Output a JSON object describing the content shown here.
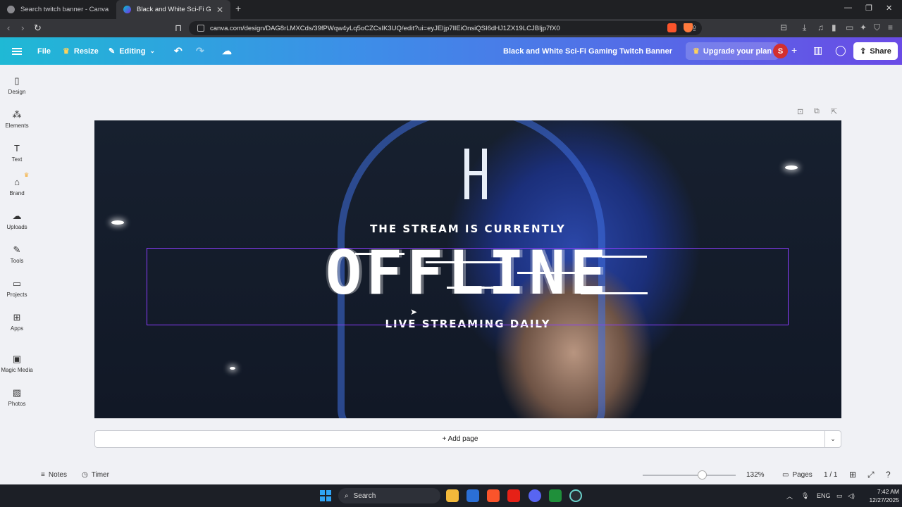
{
  "browser": {
    "tabs": [
      {
        "title": "Search twitch banner - Canva"
      },
      {
        "title": "Black and White Sci-Fi Gaming T"
      }
    ],
    "url": "canva.com/design/DAG8rLMXCds/39fPWqw4yLq5oCZCsIK3UQ/edit?ui=eyJEIjp7IlEiOnsiQSI6dHJ1ZX19LCJBIjp7fX0"
  },
  "header": {
    "file_label": "File",
    "resize_label": "Resize",
    "editing_label": "Editing",
    "doc_title": "Black and White Sci-Fi Gaming Twitch Banner",
    "upgrade_label": "Upgrade your plan",
    "avatar_initial": "S",
    "share_label": "Share"
  },
  "sidebar": {
    "items": [
      {
        "label": "Design",
        "icon": "design-icon"
      },
      {
        "label": "Elements",
        "icon": "elements-icon"
      },
      {
        "label": "Text",
        "icon": "text-icon"
      },
      {
        "label": "Brand",
        "icon": "brand-icon"
      },
      {
        "label": "Uploads",
        "icon": "uploads-icon"
      },
      {
        "label": "Tools",
        "icon": "tools-icon"
      },
      {
        "label": "Projects",
        "icon": "projects-icon"
      },
      {
        "label": "Apps",
        "icon": "apps-icon"
      },
      {
        "label": "Magic Media",
        "icon": "magic-media-icon"
      },
      {
        "label": "Photos",
        "icon": "photos-icon"
      }
    ]
  },
  "canvas": {
    "top_text": "THE STREAM IS CURRENTLY",
    "main_text": "OFFLINE",
    "bottom_text": "LIVE STREAMING DAILY"
  },
  "add_page_label": "+ Add page",
  "footer": {
    "notes_label": "Notes",
    "timer_label": "Timer",
    "zoom": "132%",
    "zoom_fraction": 0.6,
    "pages_label": "Pages",
    "page_count": "1 / 1"
  },
  "taskbar": {
    "search_placeholder": "Search",
    "language": "ENG",
    "time": "7:42 AM",
    "date": "12/27/2025"
  },
  "colors": {
    "header_gradient_start": "#1fb9d5",
    "header_gradient_end": "#6a4be6",
    "selection": "#8b3dff",
    "avatar": "#d32f2f"
  }
}
